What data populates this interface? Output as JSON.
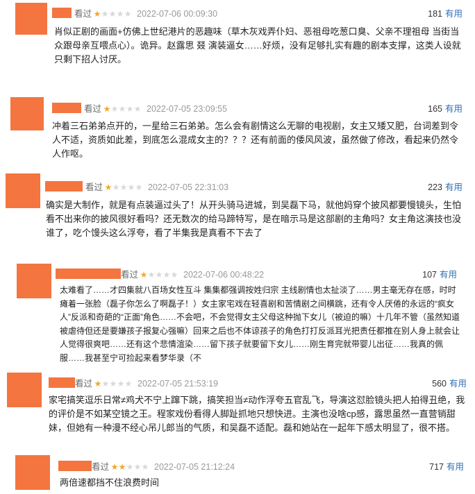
{
  "reviews": [
    {
      "status": "看过",
      "rating": 1,
      "time": "2022-07-06 00:09:30",
      "votes": "181",
      "useful_label": "有用",
      "text": "肖似正剧的画面+仿佛上世纪港片的恶趣味（草木灰戏弄仆妇、恶祖母吃葱口臭、父亲不理祖母 当街当众跟母亲互喂点心）。诡异。赵露思 叕 演装逼女……好烦，没有足够扎实有趣的剧本支撑，这类人设就只剩下招人讨厌。"
    },
    {
      "status": "看过",
      "rating": 1,
      "time": "2022-07-05 23:09:55",
      "votes": "165",
      "useful_label": "有用",
      "text": "冲着三石弟弟点开的，一星给三石弟弟。怎么会有剧情这么无聊的电视剧，女主又矮又肥，台词差到令人不适，资质如此差，到底怎么混成女主的？？？还有前面的倭风风波，虽然做了修改，看起来仍然令人作呕。"
    },
    {
      "status": "看过",
      "rating": 1,
      "time": "2022-07-05 22:31:03",
      "votes": "223",
      "useful_label": "有用",
      "text": "确实是大制作，就是有点装逼过头了！从开头骑马进城，到吴磊下马，就他妈穿个披风都要慢镜头，生怕看不出来你的披风很好看吗？还无数次的给马蹄特写，是在暗示马是这部剧的主角吗？女主角这演技也没谁了，吃个馒头这么浮夸，看了半集我是真看不下去了"
    },
    {
      "status": "看过",
      "rating": 1,
      "time": "2022-07-06 00:48:22",
      "votes": "107",
      "useful_label": "有用",
      "text": "太难看了……才四集就八百场女性互斗 集集都强调按姓归宗 主线剧情也太扯淡了……男主毫无存在感，时时瘫着一张脸（磊子你怎么了啊磊子！）女主家宅戏在轻喜剧和苦情剧之间横跳，还有令人厌倦的永远的“疯女人”反派和奇葩的“正面”角色……不会吧，不会觉得女主父母这种抛下女儿（被迫的嘛）十几年不管（虽然知道被虐待但还是要嫌孩子报复心强嘛）回来之后也不体谅孩子的角色打打反派耳光把责任都推在别人身上就会让人觉得很爽吧……还有这个悲情渲染……留下孩子就要留下女儿……刚生育完就带婴儿出征……我真的佩服……我甚至宁可捡起来看梦华录（不"
    },
    {
      "status": "看过",
      "rating": 1,
      "time": "2022-07-05 21:53:19",
      "votes": "560",
      "useful_label": "有用",
      "text": "家宅搞笑逗乐日常≠鸡犬不宁上蹿下跳，搞笑担当≠动作浮夸五官乱飞，导演这怼脸镜头把人拍得丑绝，我的评价是不如某空镜之王。程家戏份看得人脚趾抓地只想快进。主演也没啥cp感，露思虽然一直营销甜妹，但她有一种漫不经心吊儿郎当的气质，和吴磊不适配。磊和她站在一起年下感太明显了，很不搭。"
    },
    {
      "status": "看过",
      "rating": 2,
      "time": "2022-07-05 21:12:24",
      "votes": "717",
      "useful_label": "有用",
      "text": "两倍速都挡不住浪费时间"
    }
  ],
  "colors": {
    "avatar": "#f4753f",
    "star_on": "#f5a623",
    "star_off": "#d8d8d8",
    "useful_link": "#2f6fb6"
  }
}
